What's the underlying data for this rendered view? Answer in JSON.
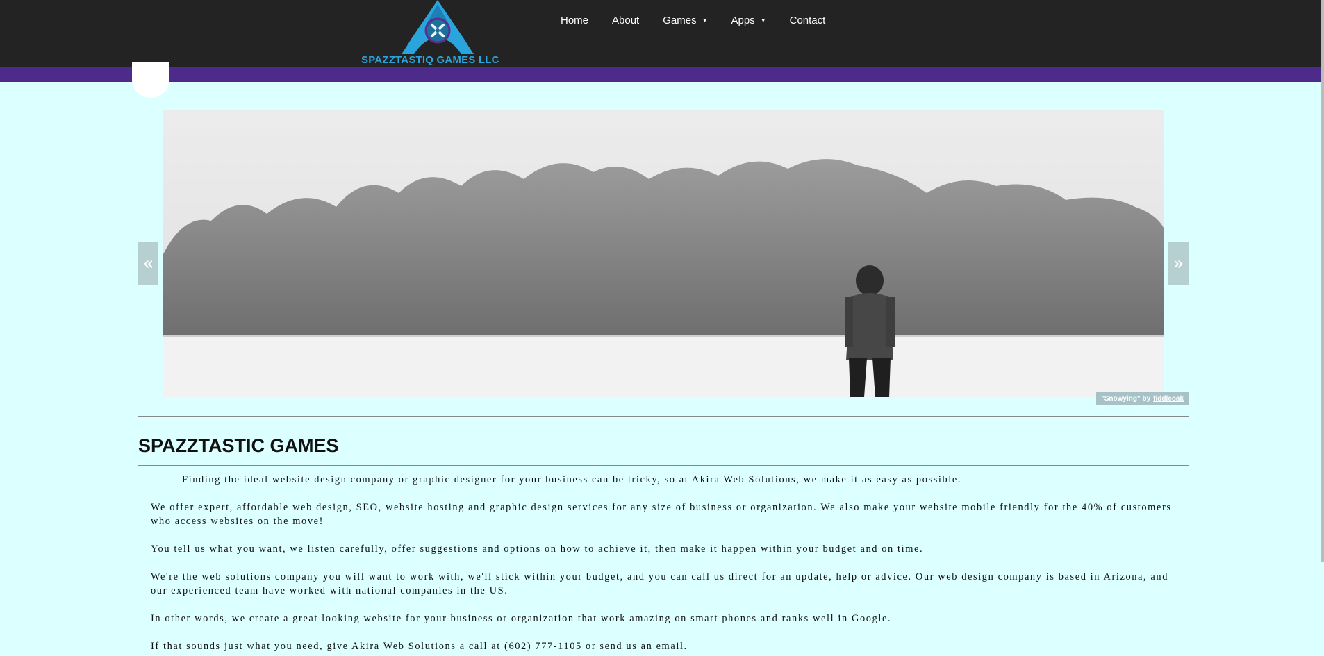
{
  "header": {
    "logo_text": "SPAZZTASTIQ GAMES LLC",
    "nav": [
      {
        "label": "Home"
      },
      {
        "label": "About"
      },
      {
        "label": "Games",
        "has_dropdown": true
      },
      {
        "label": "Apps",
        "has_dropdown": true
      },
      {
        "label": "Contact"
      }
    ]
  },
  "slider": {
    "prev_label": "«",
    "next_label": "»",
    "caption_title": "\"Snowying\" by",
    "caption_author": "fiddleoak"
  },
  "main": {
    "title": "SPAZZTASTIC GAMES",
    "paragraphs": [
      "Finding the ideal website design company or graphic designer for your business can be tricky, so at Akira Web Solutions, we make it as easy as possible.",
      "We offer expert, affordable web design, SEO, website hosting and graphic design services for any size of business or organization. We also make your website mobile friendly for the 40% of customers who access websites on the move!",
      "You tell us what you want, we listen carefully, offer suggestions and options on how to achieve it, then make it happen within your budget and on time.",
      "We're the web solutions company you will want to work with, we'll stick within your budget, and you can call us direct for an update, help or advice. Our web design company is based in Arizona, and our experienced team have worked with national companies in the US.",
      "In other words, we create a great looking website for your business or organization that work amazing on smart phones and ranks well in Google.",
      "If that sounds just what you need, give Akira Web Solutions a call at (602) 777-1105 or send us an email."
    ]
  },
  "colors": {
    "page_background": "#dcffff",
    "header_background": "#232323",
    "accent_bar": "#4d2b8a",
    "logo_blue": "#2aa4dd"
  }
}
